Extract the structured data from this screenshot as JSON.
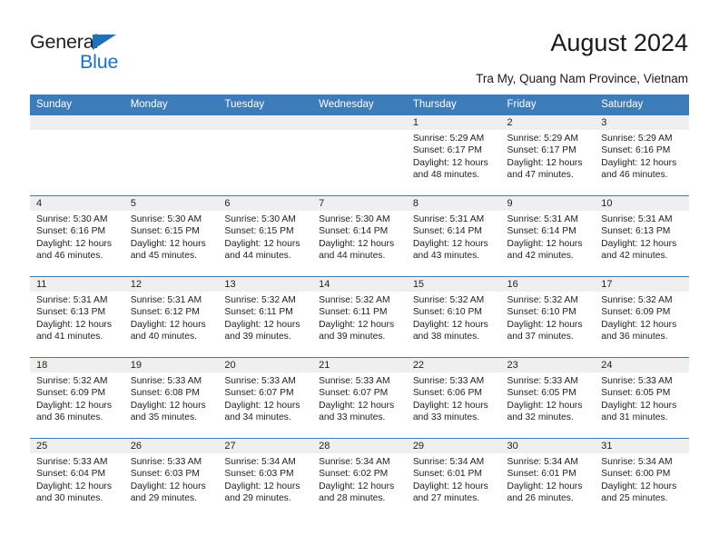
{
  "brand": {
    "name_part1": "General",
    "name_part2": "Blue",
    "triangle_icon": "triangle-icon",
    "accent_color": "#1f72b8"
  },
  "header": {
    "title": "August 2024",
    "subtitle": "Tra My, Quang Nam Province, Vietnam"
  },
  "calendar": {
    "header_bg": "#3d7cba",
    "daynum_bg": "#efefef",
    "weekdays": [
      "Sunday",
      "Monday",
      "Tuesday",
      "Wednesday",
      "Thursday",
      "Friday",
      "Saturday"
    ],
    "weeks": [
      [
        {
          "day": "",
          "empty": true
        },
        {
          "day": "",
          "empty": true
        },
        {
          "day": "",
          "empty": true
        },
        {
          "day": "",
          "empty": true
        },
        {
          "day": "1",
          "sunrise": "Sunrise: 5:29 AM",
          "sunset": "Sunset: 6:17 PM",
          "daylight1": "Daylight: 12 hours",
          "daylight2": "and 48 minutes."
        },
        {
          "day": "2",
          "sunrise": "Sunrise: 5:29 AM",
          "sunset": "Sunset: 6:17 PM",
          "daylight1": "Daylight: 12 hours",
          "daylight2": "and 47 minutes."
        },
        {
          "day": "3",
          "sunrise": "Sunrise: 5:29 AM",
          "sunset": "Sunset: 6:16 PM",
          "daylight1": "Daylight: 12 hours",
          "daylight2": "and 46 minutes."
        }
      ],
      [
        {
          "day": "4",
          "sunrise": "Sunrise: 5:30 AM",
          "sunset": "Sunset: 6:16 PM",
          "daylight1": "Daylight: 12 hours",
          "daylight2": "and 46 minutes."
        },
        {
          "day": "5",
          "sunrise": "Sunrise: 5:30 AM",
          "sunset": "Sunset: 6:15 PM",
          "daylight1": "Daylight: 12 hours",
          "daylight2": "and 45 minutes."
        },
        {
          "day": "6",
          "sunrise": "Sunrise: 5:30 AM",
          "sunset": "Sunset: 6:15 PM",
          "daylight1": "Daylight: 12 hours",
          "daylight2": "and 44 minutes."
        },
        {
          "day": "7",
          "sunrise": "Sunrise: 5:30 AM",
          "sunset": "Sunset: 6:14 PM",
          "daylight1": "Daylight: 12 hours",
          "daylight2": "and 44 minutes."
        },
        {
          "day": "8",
          "sunrise": "Sunrise: 5:31 AM",
          "sunset": "Sunset: 6:14 PM",
          "daylight1": "Daylight: 12 hours",
          "daylight2": "and 43 minutes."
        },
        {
          "day": "9",
          "sunrise": "Sunrise: 5:31 AM",
          "sunset": "Sunset: 6:14 PM",
          "daylight1": "Daylight: 12 hours",
          "daylight2": "and 42 minutes."
        },
        {
          "day": "10",
          "sunrise": "Sunrise: 5:31 AM",
          "sunset": "Sunset: 6:13 PM",
          "daylight1": "Daylight: 12 hours",
          "daylight2": "and 42 minutes."
        }
      ],
      [
        {
          "day": "11",
          "sunrise": "Sunrise: 5:31 AM",
          "sunset": "Sunset: 6:13 PM",
          "daylight1": "Daylight: 12 hours",
          "daylight2": "and 41 minutes."
        },
        {
          "day": "12",
          "sunrise": "Sunrise: 5:31 AM",
          "sunset": "Sunset: 6:12 PM",
          "daylight1": "Daylight: 12 hours",
          "daylight2": "and 40 minutes."
        },
        {
          "day": "13",
          "sunrise": "Sunrise: 5:32 AM",
          "sunset": "Sunset: 6:11 PM",
          "daylight1": "Daylight: 12 hours",
          "daylight2": "and 39 minutes."
        },
        {
          "day": "14",
          "sunrise": "Sunrise: 5:32 AM",
          "sunset": "Sunset: 6:11 PM",
          "daylight1": "Daylight: 12 hours",
          "daylight2": "and 39 minutes."
        },
        {
          "day": "15",
          "sunrise": "Sunrise: 5:32 AM",
          "sunset": "Sunset: 6:10 PM",
          "daylight1": "Daylight: 12 hours",
          "daylight2": "and 38 minutes."
        },
        {
          "day": "16",
          "sunrise": "Sunrise: 5:32 AM",
          "sunset": "Sunset: 6:10 PM",
          "daylight1": "Daylight: 12 hours",
          "daylight2": "and 37 minutes."
        },
        {
          "day": "17",
          "sunrise": "Sunrise: 5:32 AM",
          "sunset": "Sunset: 6:09 PM",
          "daylight1": "Daylight: 12 hours",
          "daylight2": "and 36 minutes."
        }
      ],
      [
        {
          "day": "18",
          "sunrise": "Sunrise: 5:32 AM",
          "sunset": "Sunset: 6:09 PM",
          "daylight1": "Daylight: 12 hours",
          "daylight2": "and 36 minutes."
        },
        {
          "day": "19",
          "sunrise": "Sunrise: 5:33 AM",
          "sunset": "Sunset: 6:08 PM",
          "daylight1": "Daylight: 12 hours",
          "daylight2": "and 35 minutes."
        },
        {
          "day": "20",
          "sunrise": "Sunrise: 5:33 AM",
          "sunset": "Sunset: 6:07 PM",
          "daylight1": "Daylight: 12 hours",
          "daylight2": "and 34 minutes."
        },
        {
          "day": "21",
          "sunrise": "Sunrise: 5:33 AM",
          "sunset": "Sunset: 6:07 PM",
          "daylight1": "Daylight: 12 hours",
          "daylight2": "and 33 minutes."
        },
        {
          "day": "22",
          "sunrise": "Sunrise: 5:33 AM",
          "sunset": "Sunset: 6:06 PM",
          "daylight1": "Daylight: 12 hours",
          "daylight2": "and 33 minutes."
        },
        {
          "day": "23",
          "sunrise": "Sunrise: 5:33 AM",
          "sunset": "Sunset: 6:05 PM",
          "daylight1": "Daylight: 12 hours",
          "daylight2": "and 32 minutes."
        },
        {
          "day": "24",
          "sunrise": "Sunrise: 5:33 AM",
          "sunset": "Sunset: 6:05 PM",
          "daylight1": "Daylight: 12 hours",
          "daylight2": "and 31 minutes."
        }
      ],
      [
        {
          "day": "25",
          "sunrise": "Sunrise: 5:33 AM",
          "sunset": "Sunset: 6:04 PM",
          "daylight1": "Daylight: 12 hours",
          "daylight2": "and 30 minutes."
        },
        {
          "day": "26",
          "sunrise": "Sunrise: 5:33 AM",
          "sunset": "Sunset: 6:03 PM",
          "daylight1": "Daylight: 12 hours",
          "daylight2": "and 29 minutes."
        },
        {
          "day": "27",
          "sunrise": "Sunrise: 5:34 AM",
          "sunset": "Sunset: 6:03 PM",
          "daylight1": "Daylight: 12 hours",
          "daylight2": "and 29 minutes."
        },
        {
          "day": "28",
          "sunrise": "Sunrise: 5:34 AM",
          "sunset": "Sunset: 6:02 PM",
          "daylight1": "Daylight: 12 hours",
          "daylight2": "and 28 minutes."
        },
        {
          "day": "29",
          "sunrise": "Sunrise: 5:34 AM",
          "sunset": "Sunset: 6:01 PM",
          "daylight1": "Daylight: 12 hours",
          "daylight2": "and 27 minutes."
        },
        {
          "day": "30",
          "sunrise": "Sunrise: 5:34 AM",
          "sunset": "Sunset: 6:01 PM",
          "daylight1": "Daylight: 12 hours",
          "daylight2": "and 26 minutes."
        },
        {
          "day": "31",
          "sunrise": "Sunrise: 5:34 AM",
          "sunset": "Sunset: 6:00 PM",
          "daylight1": "Daylight: 12 hours",
          "daylight2": "and 25 minutes."
        }
      ]
    ]
  }
}
